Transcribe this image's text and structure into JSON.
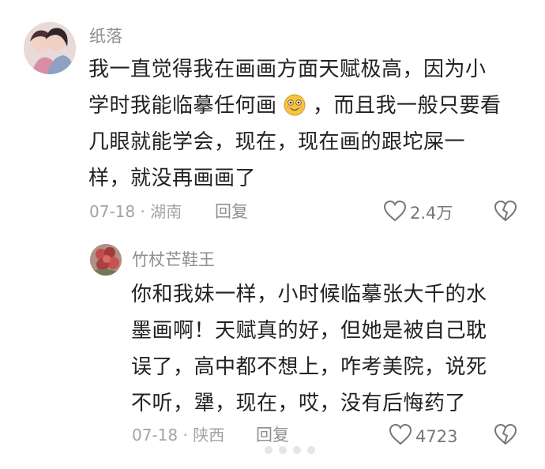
{
  "comments": [
    {
      "username": "纸落",
      "lines": [
        "我一直觉得我在画画方面天赋极高，因为小",
        "学时我能临摹任何画",
        "，而且我一般只要看",
        "几眼就能学会，现在，现在画的跟坨屎一",
        "样，就没再画画了"
      ],
      "emoji_icon": "smiling-face-emoji",
      "date": "07-18",
      "separator": "·",
      "location": "湖南",
      "reply_label": "回复",
      "likes": "2.4万"
    },
    {
      "username": "竹杖芒鞋王",
      "lines": [
        "你和我妹一样，小时候临摹张大千的水",
        "墨画啊！天赋真的好，但她是被自己耽",
        "误了，高中都不想上，咋考美院，说死",
        "不听，犟，现在，哎，没有后悔药了"
      ],
      "date": "07-18",
      "separator": "·",
      "location": "陕西",
      "reply_label": "回复",
      "likes": "4723"
    }
  ],
  "colors": {
    "text": "#222222",
    "muted": "#a3a3a3",
    "username": "#8f8f8f",
    "icon": "#777777"
  }
}
